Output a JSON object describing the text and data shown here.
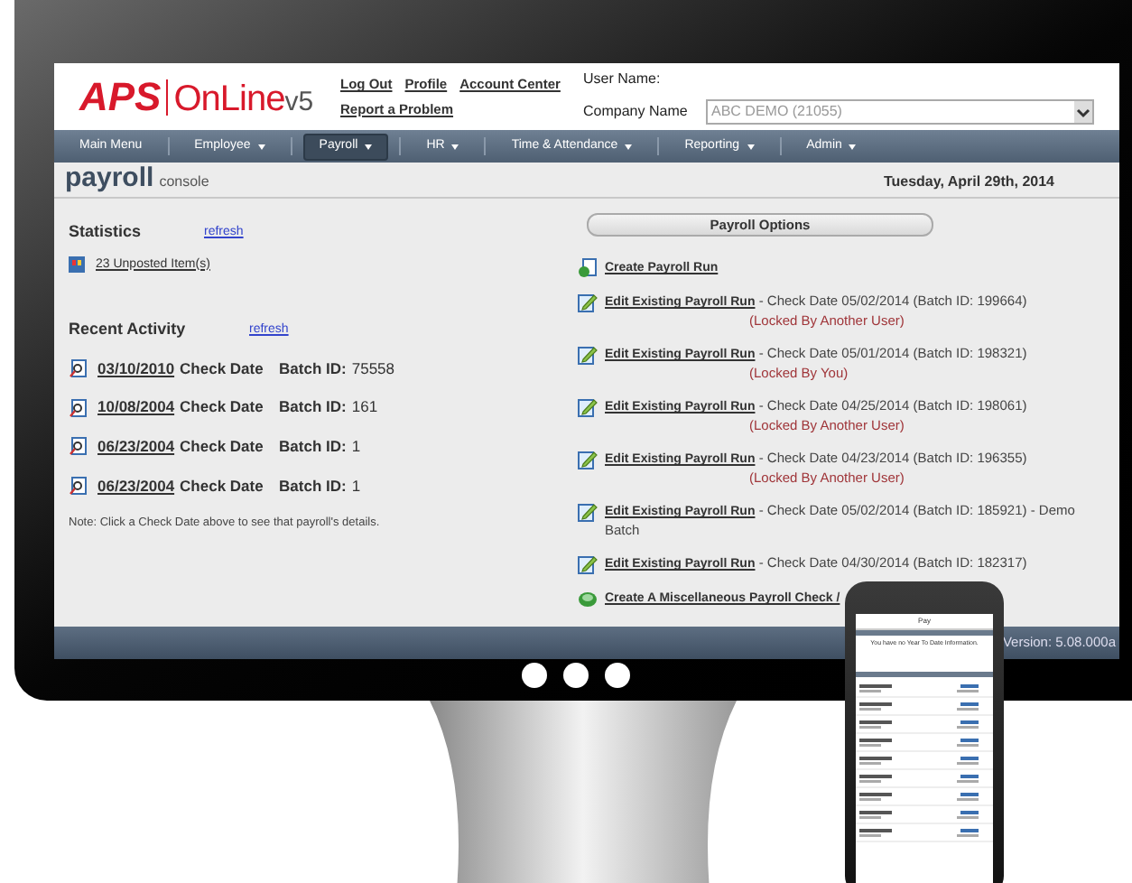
{
  "header": {
    "logo": {
      "brand": "APS",
      "product": "OnLine",
      "version": "v5"
    },
    "links": [
      {
        "label": "Log Out"
      },
      {
        "label": "Profile"
      },
      {
        "label": "Account Center"
      },
      {
        "label": "Report a Problem"
      }
    ],
    "user_label": "User Name:",
    "company_label": "Company Name",
    "company_value": "ABC DEMO (21055)"
  },
  "nav": [
    {
      "label": "Main Menu",
      "dropdown": false,
      "selected": false
    },
    {
      "label": "Employee",
      "dropdown": true,
      "selected": false
    },
    {
      "label": "Payroll",
      "dropdown": true,
      "selected": true
    },
    {
      "label": "HR",
      "dropdown": true,
      "selected": false
    },
    {
      "label": "Time & Attendance",
      "dropdown": true,
      "selected": false
    },
    {
      "label": "Reporting",
      "dropdown": true,
      "selected": false
    },
    {
      "label": "Admin",
      "dropdown": true,
      "selected": false
    }
  ],
  "page": {
    "title": "payroll",
    "subtitle": "console",
    "date": "Tuesday, April 29th, 2014"
  },
  "statistics": {
    "title": "Statistics",
    "refresh": "refresh",
    "unposted": "23 Unposted Item(s)"
  },
  "recent": {
    "title": "Recent Activity",
    "refresh": "refresh",
    "rows": [
      {
        "date": "03/10/2010",
        "check_label": "Check Date",
        "batch_label": "Batch ID:",
        "batch": "75558"
      },
      {
        "date": "10/08/2004",
        "check_label": "Check Date",
        "batch_label": "Batch ID:",
        "batch": "161"
      },
      {
        "date": "06/23/2004",
        "check_label": "Check Date",
        "batch_label": "Batch ID:",
        "batch": "1"
      },
      {
        "date": "06/23/2004",
        "check_label": "Check Date",
        "batch_label": "Batch ID:",
        "batch": "1"
      }
    ],
    "note": "Note: Click a Check Date above to see that payroll's details."
  },
  "options": {
    "title": "Payroll Options",
    "items": [
      {
        "kind": "create",
        "link": "Create Payroll Run"
      },
      {
        "kind": "edit",
        "link": "Edit Existing Payroll Run",
        "detail": "- Check Date 05/02/2014 (Batch ID: 199664)",
        "lock": "(Locked By Another User)"
      },
      {
        "kind": "edit",
        "link": "Edit Existing Payroll Run",
        "detail": "- Check Date 05/01/2014 (Batch ID: 198321)",
        "lock": "(Locked By You)"
      },
      {
        "kind": "edit",
        "link": "Edit Existing Payroll Run",
        "detail": "- Check Date 04/25/2014 (Batch ID: 198061)",
        "lock": "(Locked By Another User)"
      },
      {
        "kind": "edit",
        "link": "Edit Existing Payroll Run",
        "detail": "- Check Date 04/23/2014 (Batch ID: 196355)",
        "lock": "(Locked By Another User)"
      },
      {
        "kind": "edit",
        "link": "Edit Existing Payroll Run",
        "detail": "- Check Date 05/02/2014 (Batch ID: 185921) - Demo Batch"
      },
      {
        "kind": "edit",
        "link": "Edit Existing Payroll Run",
        "detail": "- Check Date 04/30/2014 (Batch ID: 182317)"
      },
      {
        "kind": "misc",
        "link": "Create A Miscellaneous Payroll Check /"
      }
    ]
  },
  "footer": {
    "version": "Version: 5.08.000a"
  },
  "phone": {
    "title": "Pay",
    "message": "You have no Year To Date Information."
  }
}
